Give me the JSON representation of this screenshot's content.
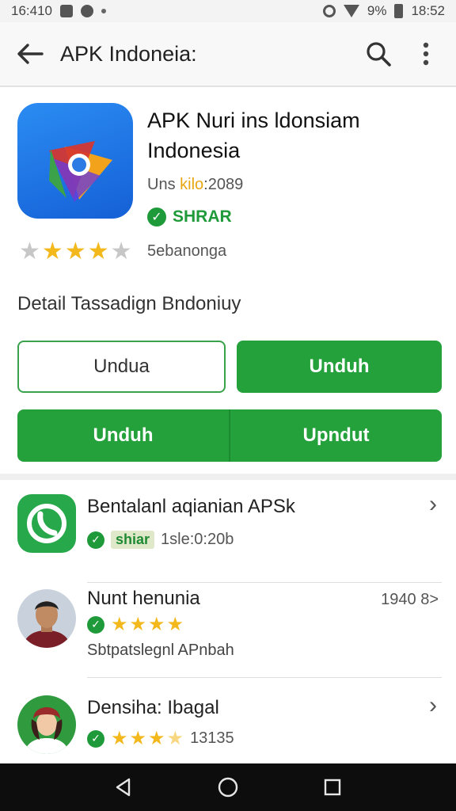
{
  "status_bar": {
    "time_left": "16:41",
    "time_left_suffix": "0",
    "battery": "9%",
    "time_right": "18:52"
  },
  "app_bar": {
    "title": "APK Indoneia:"
  },
  "app": {
    "name": "APK Nuri ins ldonsiam Indonesia",
    "meta_prefix": "Uns",
    "meta_highlight": "kilo",
    "meta_suffix": ":2089",
    "verified_label": "SHRAR",
    "rating": 4,
    "rating_max": 5,
    "rating_label": "5ebanonga"
  },
  "detail_title": "Detail Tassadign Bndoniuy",
  "buttons": {
    "outline_label": "Undua",
    "green_label": "Unduh",
    "pair_left_label": "Unduh",
    "pair_right_label": "Upndut"
  },
  "list": [
    {
      "title": "Bentalanl aqianian APSk",
      "tag": "shiar",
      "meta": "1sle:0:20b"
    },
    {
      "title": "Nunt henunia",
      "rating": 4,
      "right_text": "1940 8>",
      "subtitle": "Sbtpatslegnl APnbah"
    },
    {
      "title": "Densiha: Ibagal",
      "rating": 3.5,
      "meta": "13135"
    }
  ],
  "colors": {
    "primary_green": "#24a13b",
    "verified_green": "#1f9a3a",
    "star_yellow": "#f3b81c",
    "app_icon_blue": "#1f6fe5"
  },
  "icons": {
    "back": "arrow-left-icon",
    "search": "search-icon",
    "menu": "more-vertical-icon",
    "verified": "check-circle-icon",
    "chevron": "chevron-right-icon",
    "nav_back": "triangle-back-icon",
    "nav_home": "circle-home-icon",
    "nav_recents": "square-recents-icon"
  }
}
